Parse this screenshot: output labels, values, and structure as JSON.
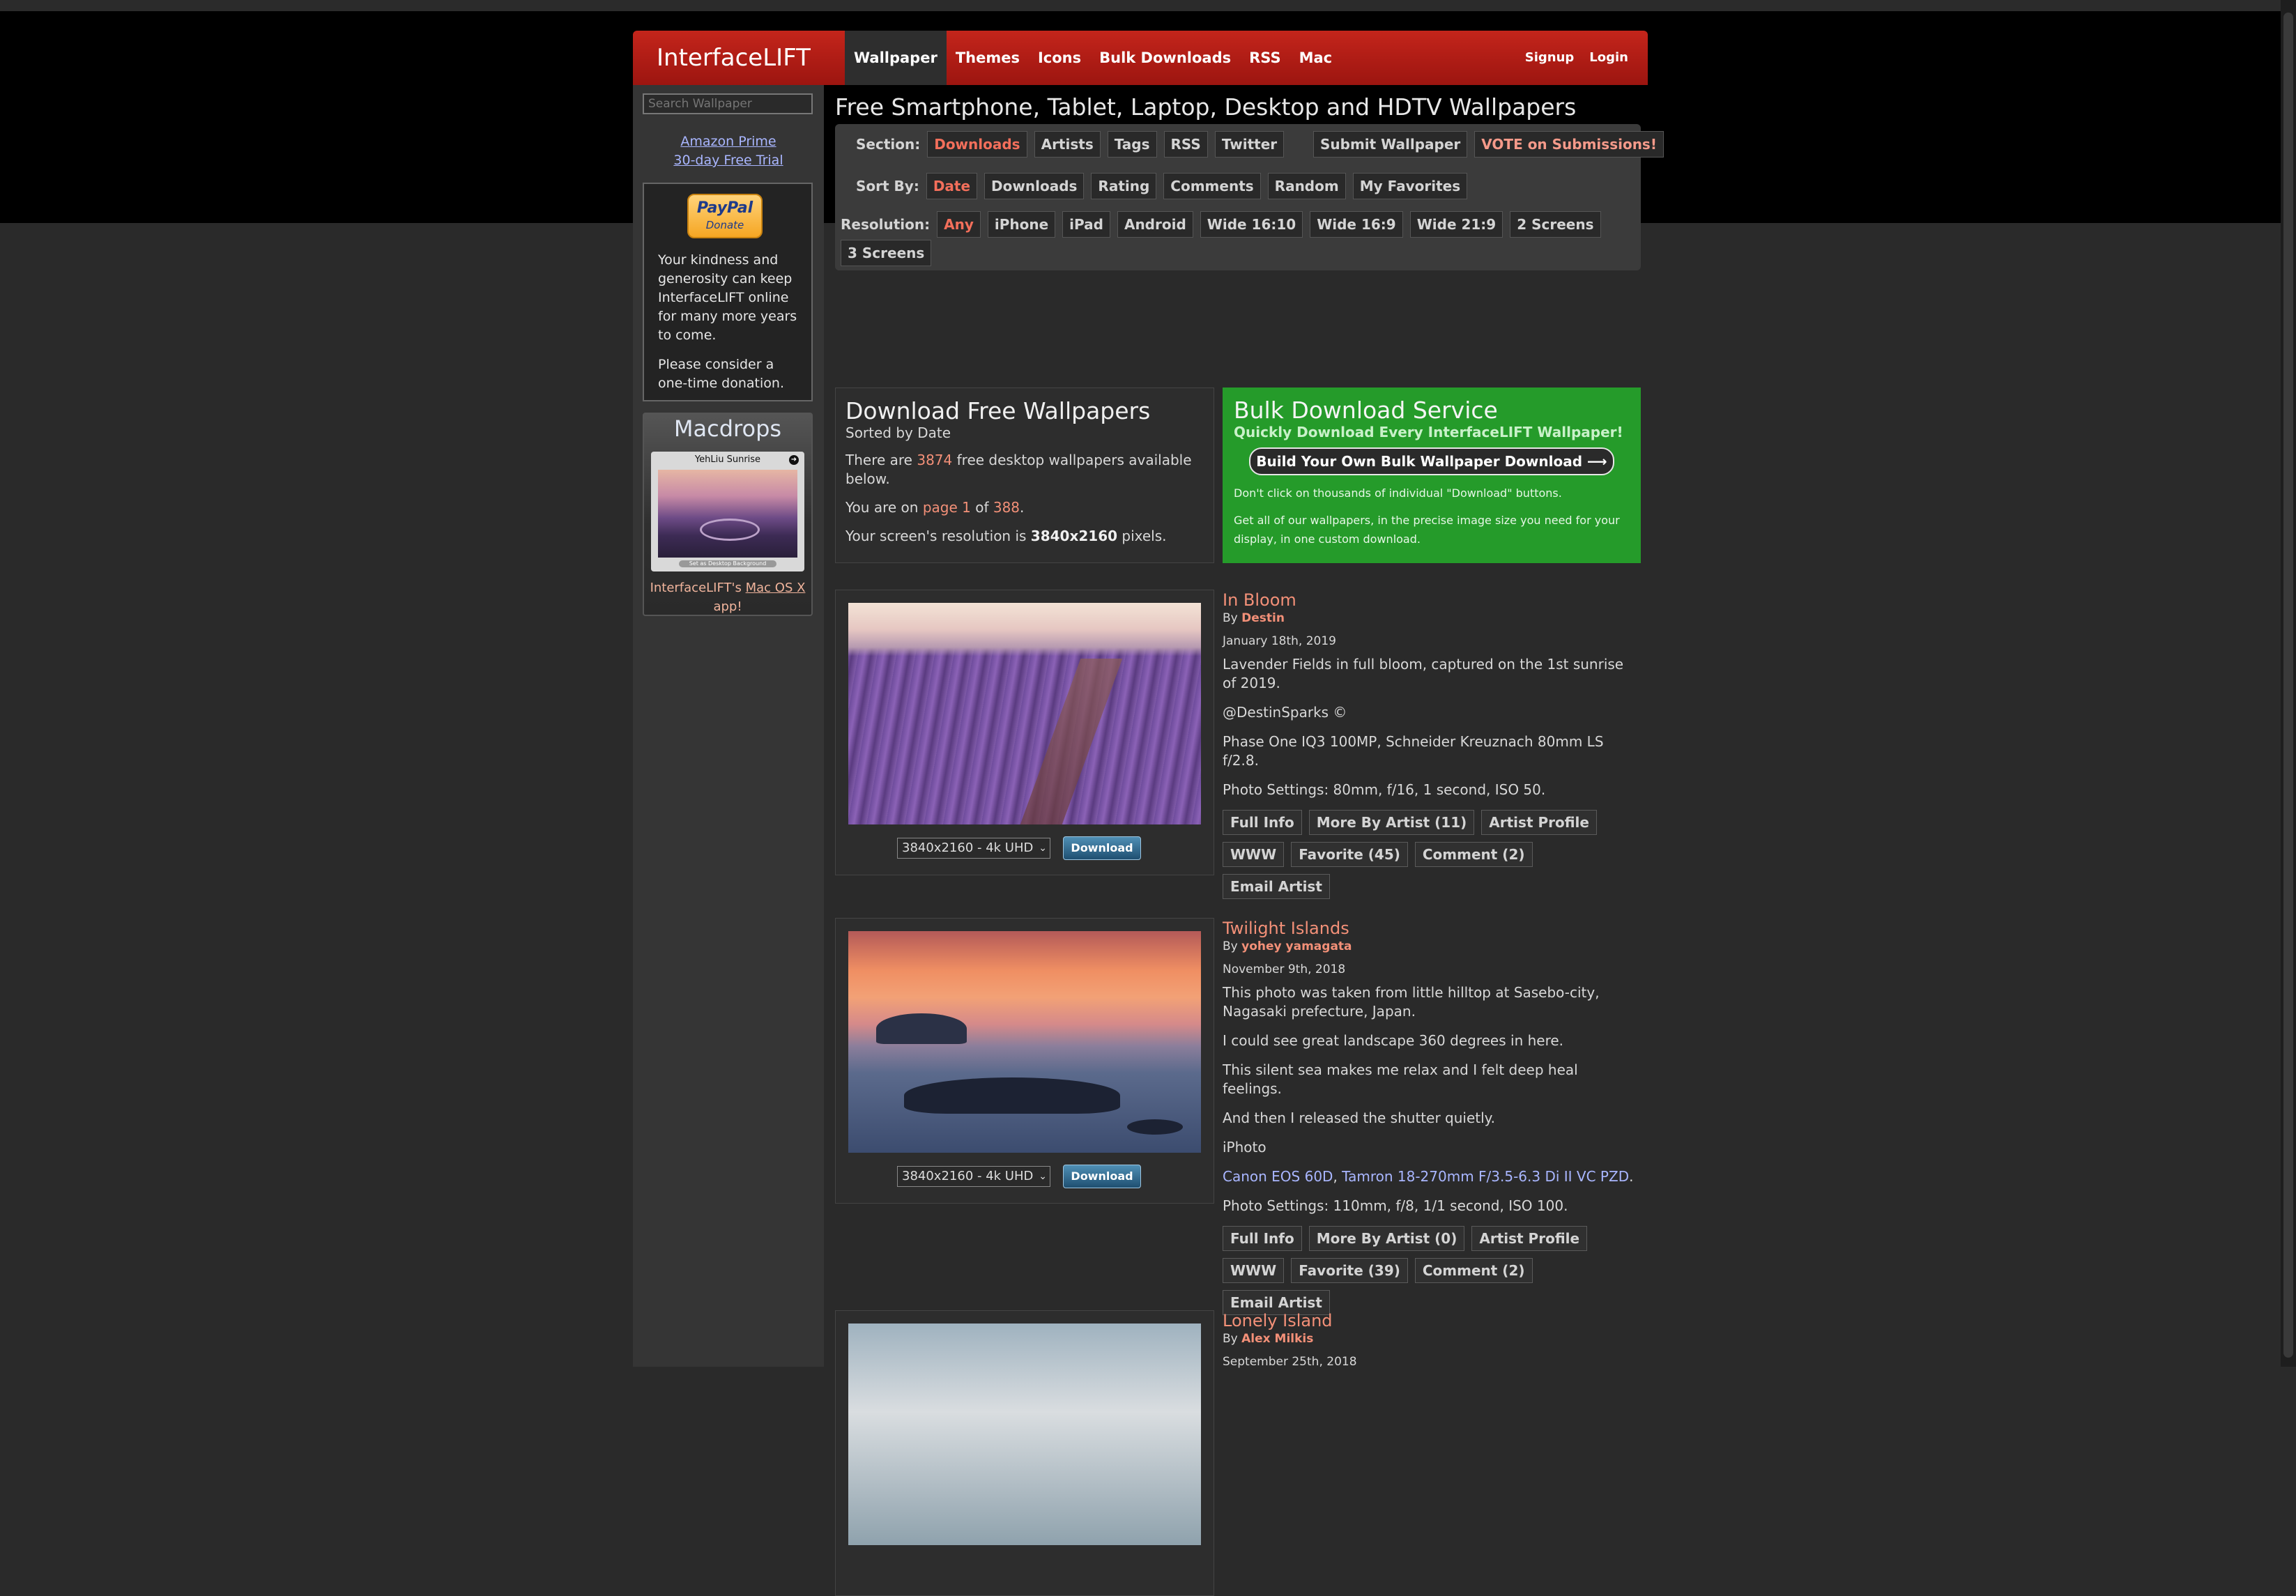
{
  "header": {
    "logo": "InterfaceLIFT",
    "nav": [
      "Wallpaper",
      "Themes",
      "Icons",
      "Bulk Downloads",
      "RSS",
      "Mac"
    ],
    "signup": "Signup",
    "login": "Login"
  },
  "sidebar": {
    "search_placeholder": "Search Wallpaper",
    "amazon_line1": "Amazon Prime",
    "amazon_line2": "30-day Free Trial",
    "paypal_brand": "PayPal",
    "paypal_donate": "Donate",
    "donate_text1": "Your kindness and generosity can keep InterfaceLIFT online for many more years to come.",
    "donate_text2": "Please consider a one-time donation.",
    "macdrops_title": "Macdrops",
    "macdrops_caption": "YehLiu Sunrise",
    "macdrops_btn": "Set as Desktop Background",
    "macdrops_app_prefix": "InterfaceLIFT's",
    "macdrops_app_link": "Mac OS X",
    "macdrops_app_suffix": "app!"
  },
  "main": {
    "page_title": "Free Smartphone, Tablet, Laptop, Desktop and HDTV Wallpapers",
    "section_label": "Section:",
    "section_items": [
      "Downloads",
      "Artists",
      "Tags",
      "RSS",
      "Twitter"
    ],
    "submit_wallpaper": "Submit Wallpaper",
    "vote_submissions": "VOTE on Submissions!",
    "sort_label": "Sort By:",
    "sort_items": [
      "Date",
      "Downloads",
      "Rating",
      "Comments",
      "Random",
      "My Favorites"
    ],
    "resolution_label": "Resolution:",
    "resolution_items": [
      "Any",
      "iPhone",
      "iPad",
      "Android",
      "Wide 16:10",
      "Wide 16:9",
      "Wide 21:9",
      "2 Screens",
      "3 Screens"
    ]
  },
  "info": {
    "title": "Download Free Wallpapers",
    "subtitle": "Sorted by Date",
    "count_prefix": "There are",
    "count": "3874",
    "count_suffix": "free desktop wallpapers available below.",
    "page_prefix": "You are on",
    "page": "page 1",
    "page_of": "of",
    "page_total": "388",
    "res_prefix": "Your screen's resolution is",
    "resolution": "3840x2160",
    "res_suffix": "pixels."
  },
  "bulk": {
    "title": "Bulk Download Service",
    "subtitle": "Quickly Download Every InterfaceLIFT Wallpaper!",
    "button": "Build Your Own Bulk Wallpaper Download ⟶",
    "text1": "Don't click on thousands of individual \"Download\" buttons.",
    "text2": "Get all of our wallpapers, in the precise image size you need for your display, in one custom download."
  },
  "wallpapers": [
    {
      "title": "In Bloom",
      "by": "By",
      "artist": "Destin",
      "date": "January 18th, 2019",
      "desc": [
        "Lavender Fields in full bloom, captured on the 1st sunrise of 2019.",
        "@DestinSparks ©",
        "Phase One IQ3 100MP, Schneider Kreuznach 80mm LS f/2.8.",
        "Photo Settings: 80mm, f/16, 1 second, ISO 50."
      ],
      "resolution_select": "3840x2160 - 4k UHD",
      "download": "Download",
      "buttons": [
        "Full Info",
        "More By Artist (11)",
        "Artist Profile",
        "WWW",
        "Favorite (45)",
        "Comment (2)",
        "Email Artist"
      ]
    },
    {
      "title": "Twilight Islands",
      "by": "By",
      "artist": "yohey yamagata",
      "date": "November 9th, 2018",
      "desc": [
        "This photo was taken from little hilltop at Sasebo-city, Nagasaki prefecture, Japan.",
        "I could see great landscape 360 degrees in here.",
        "This silent sea makes me relax and I felt deep heal feelings.",
        "And then I released the shutter quietly.",
        "iPhoto"
      ],
      "gear_link1": "Canon EOS 60D",
      "gear_sep": ",",
      "gear_link2": "Tamron 18-270mm F/3.5-6.3 Di II VC PZD",
      "gear_end": ".",
      "settings": "Photo Settings: 110mm, f/8, 1/1 second, ISO 100.",
      "resolution_select": "3840x2160 - 4k UHD",
      "download": "Download",
      "buttons": [
        "Full Info",
        "More By Artist (0)",
        "Artist Profile",
        "WWW",
        "Favorite (39)",
        "Comment (2)",
        "Email Artist"
      ]
    },
    {
      "title": "Lonely Island",
      "by": "By",
      "artist": "Alex Milkis",
      "date": "September 25th, 2018"
    }
  ]
}
